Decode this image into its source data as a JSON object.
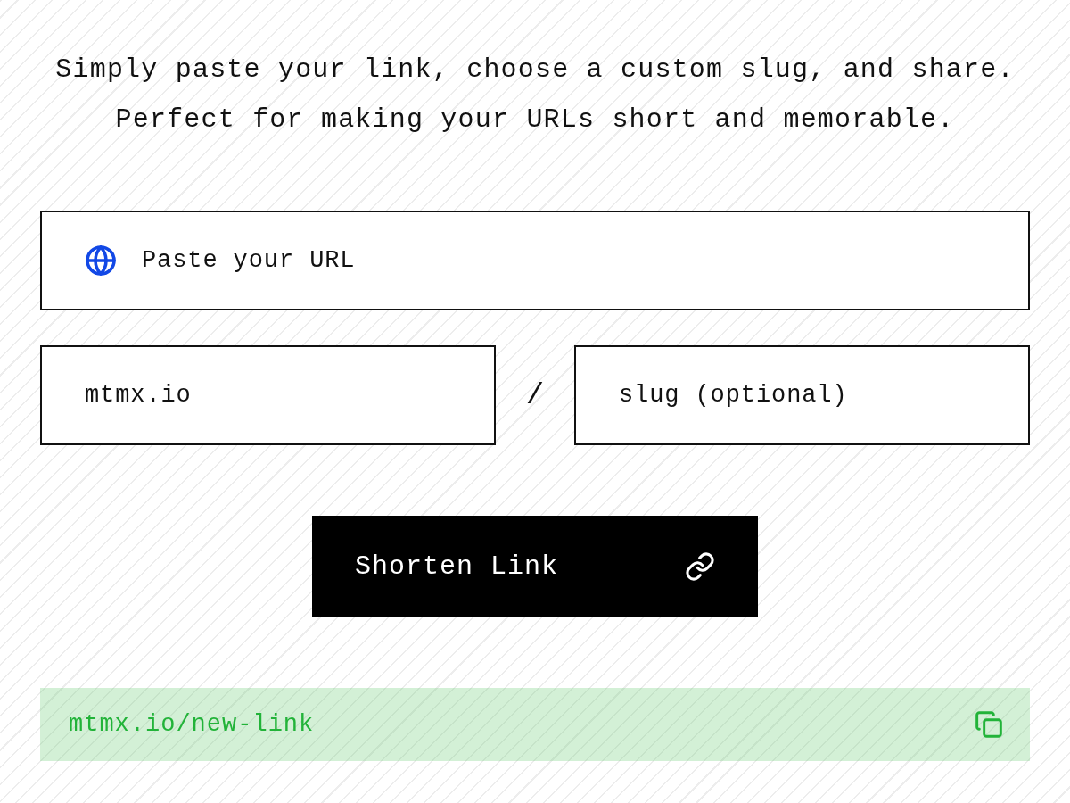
{
  "intro": {
    "lines": [
      "Simply paste your link, choose a custom slug, and share.",
      "Perfect for making your URLs short and memorable."
    ]
  },
  "url_field": {
    "placeholder": "Paste your URL"
  },
  "domain_field": {
    "value": "mtmx.io"
  },
  "separator": "/",
  "slug_field": {
    "placeholder": "slug (optional)"
  },
  "shorten_button": {
    "label": "Shorten Link"
  },
  "result": {
    "short_url": "mtmx.io/new-link"
  }
}
